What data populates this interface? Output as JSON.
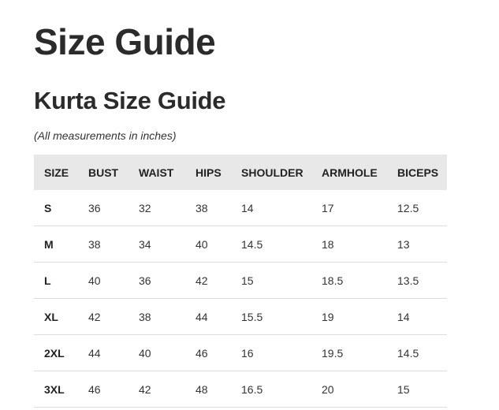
{
  "page": {
    "title": "Size Guide",
    "section_title": "Kurta Size Guide",
    "note": "(All measurements in inches)"
  },
  "table": {
    "headers": [
      "SIZE",
      "BUST",
      "WAIST",
      "HIPS",
      "SHOULDER",
      "ARMHOLE",
      "BICEPS"
    ],
    "rows": [
      [
        "S",
        "36",
        "32",
        "38",
        "14",
        "17",
        "12.5"
      ],
      [
        "M",
        "38",
        "34",
        "40",
        "14.5",
        "18",
        "13"
      ],
      [
        "L",
        "40",
        "36",
        "42",
        "15",
        "18.5",
        "13.5"
      ],
      [
        "XL",
        "42",
        "38",
        "44",
        "15.5",
        "19",
        "14"
      ],
      [
        "2XL",
        "44",
        "40",
        "46",
        "16",
        "19.5",
        "14.5"
      ],
      [
        "3XL",
        "46",
        "42",
        "48",
        "16.5",
        "20",
        "15"
      ]
    ]
  }
}
